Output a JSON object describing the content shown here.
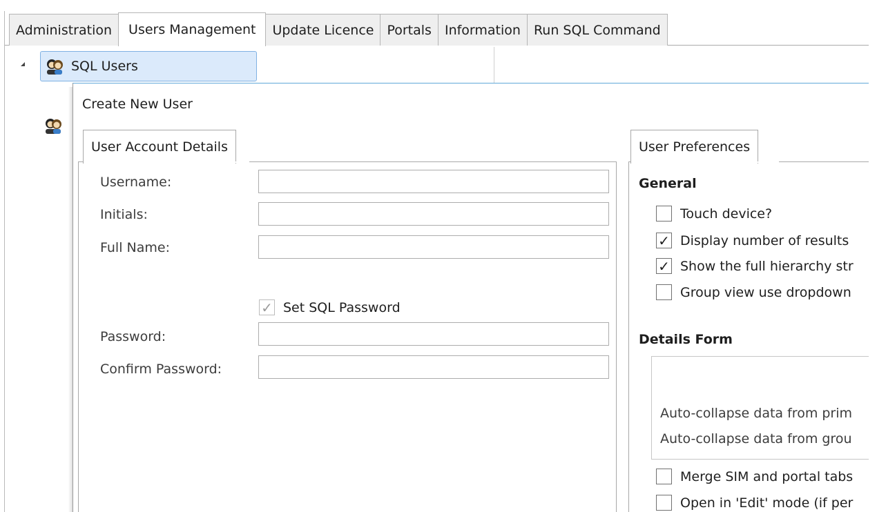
{
  "tabs": [
    {
      "label": "Administration"
    },
    {
      "label": "Users Management",
      "active": true
    },
    {
      "label": "Update Licence"
    },
    {
      "label": "Portals"
    },
    {
      "label": "Information"
    },
    {
      "label": "Run SQL Command"
    }
  ],
  "tree": {
    "root_label": "SQL Users",
    "icon": "user-group-icon"
  },
  "dialog": {
    "title": "Create New User",
    "account_group": {
      "header": "User Account Details",
      "fields": [
        {
          "label": "Username:",
          "value": ""
        },
        {
          "label": "Initials:",
          "value": ""
        },
        {
          "label": "Full Name:",
          "value": ""
        }
      ],
      "set_password": {
        "label": "Set SQL Password",
        "checked": true,
        "disabled": true
      },
      "password_fields": [
        {
          "label": "Password:",
          "value": ""
        },
        {
          "label": "Confirm Password:",
          "value": ""
        }
      ]
    },
    "preferences_group": {
      "header": "User Preferences",
      "general_title": "General",
      "general_options": [
        {
          "label": "Touch device?",
          "checked": false
        },
        {
          "label": "Display number of results",
          "checked": true
        },
        {
          "label": "Show the full hierarchy str",
          "checked": true
        },
        {
          "label": "Group view use dropdown",
          "checked": false
        }
      ],
      "details_title": "Details Form",
      "details_lines": [
        "Auto-collapse data from prim",
        "Auto-collapse data from grou"
      ],
      "bottom_options": [
        {
          "label": "Merge SIM and portal tabs",
          "checked": false
        },
        {
          "label": "Open in 'Edit' mode (if per",
          "checked": false
        }
      ]
    }
  }
}
